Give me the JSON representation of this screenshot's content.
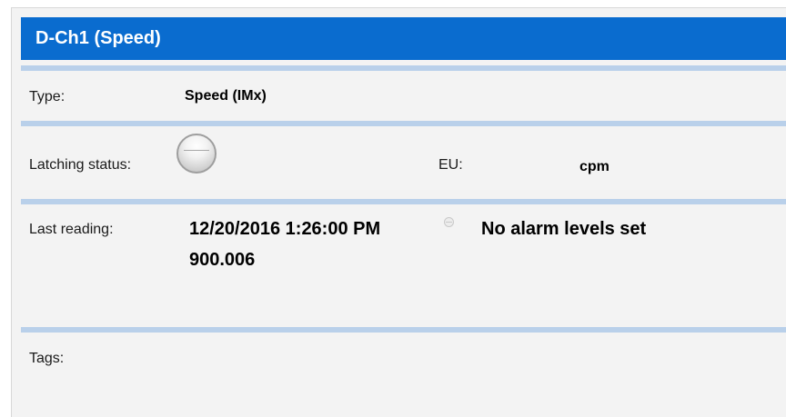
{
  "channel": {
    "title": "D-Ch1 (Speed)"
  },
  "fields": {
    "type_label": "Type:",
    "type_value": "Speed (IMx)",
    "latching_label": "Latching status:",
    "latching_state": "off",
    "eu_label": "EU:",
    "eu_value": "cpm",
    "last_reading_label": "Last reading:",
    "last_reading_timestamp": "12/20/2016 1:26:00 PM",
    "last_reading_value": "900.006",
    "alarm_status": "No alarm levels set",
    "tags_label": "Tags:"
  },
  "colors": {
    "header_bg": "#0a6ccf",
    "separator": "#b9d0ea",
    "panel_bg": "#f3f3f3"
  },
  "icons": {
    "latching": "latching-status-indicator-icon",
    "alarm": "alarm-status-icon"
  }
}
